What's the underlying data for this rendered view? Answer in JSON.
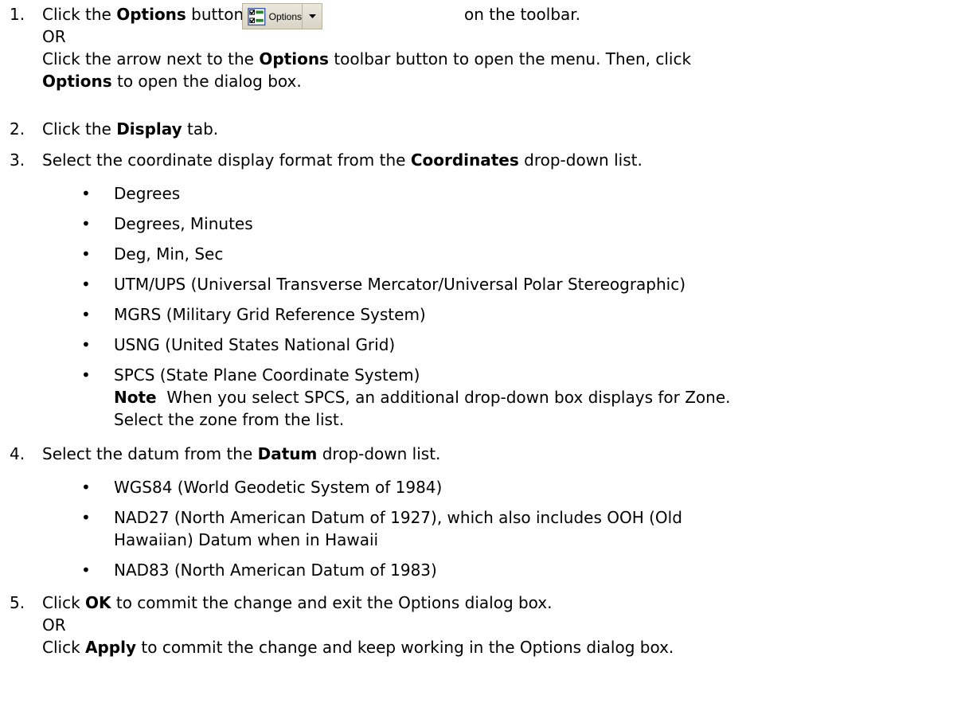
{
  "steps": [
    {
      "number": "1.",
      "line1_pre": "Click the ",
      "line1_bold": "Options",
      "line1_mid": " button",
      "line1_post": "on the toolbar.",
      "or": "OR",
      "line3_pre": "Click the arrow next to the ",
      "line3_bold": "Options",
      "line3_post": " toolbar button to open the menu. Then, click",
      "line4_bold": "Options",
      "line4_post": " to open the dialog box."
    },
    {
      "number": "2.",
      "pre": "Click the ",
      "bold": "Display",
      "post": " tab."
    },
    {
      "number": "3.",
      "pre": "Select the coordinate display format from the ",
      "bold": "Coordinates",
      "post": " drop-down list."
    },
    {
      "number": "4.",
      "pre": "Select the datum from the ",
      "bold": "Datum",
      "post": " drop-down list."
    },
    {
      "number": "5.",
      "line1_pre": "Click ",
      "line1_bold": "OK",
      "line1_post": " to commit the change and exit the Options dialog box.",
      "or": "OR",
      "line3_pre": "Click ",
      "line3_bold": "Apply",
      "line3_post": " to commit the change and keep working in the Options dialog box."
    }
  ],
  "toolbar_button": {
    "label": "Options",
    "icon": "checklist-icon",
    "arrow_icon": "dropdown-arrow-icon"
  },
  "coordinate_formats": [
    "Degrees",
    "Degrees, Minutes",
    "Deg, Min, Sec",
    "UTM/UPS (Universal Transverse Mercator/Universal Polar Stereographic)",
    "MGRS (Military Grid Reference System)",
    "USNG (United States National Grid)",
    "SPCS (State Plane Coordinate System)"
  ],
  "spcs_note": {
    "label": "Note",
    "line1": "  When you select SPCS, an additional drop-down box displays for Zone.",
    "line2": "Select the zone from the list."
  },
  "datums": [
    {
      "line1": "WGS84 (World Geodetic System of 1984)"
    },
    {
      "line1": "NAD27 (North American Datum of 1927), which also includes OOH (Old",
      "line2": "Hawaiian) Datum when in Hawaii"
    },
    {
      "line1": "NAD83 (North American Datum of 1983)"
    }
  ],
  "bullet_glyph": "•"
}
